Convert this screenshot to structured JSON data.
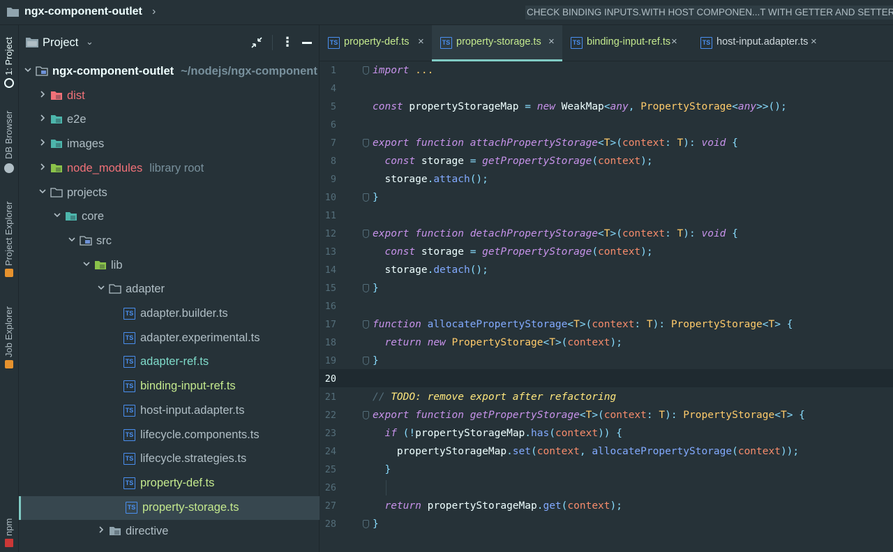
{
  "navbar": {
    "project_name": "ngx-component-outlet",
    "run_config": "CHECK BINDING INPUTS.WITH HOST COMPONEN...T WITH GETTER AND SETTER.A"
  },
  "tool_strip": [
    {
      "label": "1: Project",
      "active": true
    },
    {
      "label": "DB Browser",
      "active": false
    },
    {
      "label": "Project Explorer",
      "active": false
    },
    {
      "label": "Job Explorer",
      "active": false
    },
    {
      "label": "npm",
      "active": false
    }
  ],
  "panel": {
    "title": "Project"
  },
  "tree": [
    {
      "name": "ngx-component-outlet",
      "hint": "~/nodejs/ngx-component",
      "depth": 0,
      "expanded": true,
      "icon": "folder",
      "color": "default",
      "bold": true
    },
    {
      "name": "dist",
      "depth": 1,
      "expanded": false,
      "icon": "folder-red",
      "color": "red"
    },
    {
      "name": "e2e",
      "depth": 1,
      "expanded": false,
      "icon": "folder-teal",
      "color": "default"
    },
    {
      "name": "images",
      "depth": 1,
      "expanded": false,
      "icon": "folder-teal",
      "color": "default"
    },
    {
      "name": "node_modules",
      "hint": "library root",
      "depth": 1,
      "expanded": false,
      "icon": "folder-green",
      "color": "red"
    },
    {
      "name": "projects",
      "depth": 1,
      "expanded": true,
      "icon": "folder-outline",
      "color": "default"
    },
    {
      "name": "core",
      "depth": 2,
      "expanded": true,
      "icon": "folder-teal",
      "color": "default"
    },
    {
      "name": "src",
      "depth": 3,
      "expanded": true,
      "icon": "folder-blue",
      "color": "default"
    },
    {
      "name": "lib",
      "depth": 4,
      "expanded": true,
      "icon": "folder-green",
      "color": "default"
    },
    {
      "name": "adapter",
      "depth": 5,
      "expanded": true,
      "icon": "folder-outline",
      "color": "default"
    },
    {
      "name": "adapter.builder.ts",
      "depth": 6,
      "icon": "ts",
      "color": "normal"
    },
    {
      "name": "adapter.experimental.ts",
      "depth": 6,
      "icon": "ts",
      "color": "normal"
    },
    {
      "name": "adapter-ref.ts",
      "depth": 6,
      "icon": "ts",
      "color": "modified"
    },
    {
      "name": "binding-input-ref.ts",
      "depth": 6,
      "icon": "ts",
      "color": "green"
    },
    {
      "name": "host-input.adapter.ts",
      "depth": 6,
      "icon": "ts",
      "color": "normal"
    },
    {
      "name": "lifecycle.components.ts",
      "depth": 6,
      "icon": "ts",
      "color": "normal"
    },
    {
      "name": "lifecycle.strategies.ts",
      "depth": 6,
      "icon": "ts",
      "color": "normal"
    },
    {
      "name": "property-def.ts",
      "depth": 6,
      "icon": "ts",
      "color": "green"
    },
    {
      "name": "property-storage.ts",
      "depth": 6,
      "icon": "ts",
      "color": "green",
      "selected": true
    },
    {
      "name": "directive",
      "depth": 5,
      "expanded": false,
      "icon": "folder-grey",
      "color": "normal"
    }
  ],
  "tabs": [
    {
      "label": "property-def.ts",
      "color": "green",
      "active": false
    },
    {
      "label": "property-storage.ts",
      "color": "green",
      "active": true
    },
    {
      "label": "binding-input-ref.ts",
      "color": "green",
      "active": false
    },
    {
      "label": "host-input.adapter.ts",
      "color": "normal",
      "active": false
    }
  ],
  "ts_badge": "TS",
  "current_line": 20,
  "code_lines": [
    {
      "n": "1",
      "tokens": [
        [
          "kw",
          "import"
        ],
        [
          "p",
          " "
        ],
        [
          "ty",
          "..."
        ]
      ]
    },
    {
      "n": "4",
      "tokens": []
    },
    {
      "n": "5",
      "tokens": [
        [
          "kw",
          "const"
        ],
        [
          "p",
          " propertyStorageMap "
        ],
        [
          "pu",
          "="
        ],
        [
          "p",
          " "
        ],
        [
          "kw",
          "new"
        ],
        [
          "p",
          " WeakMap"
        ],
        [
          "pu",
          "<"
        ],
        [
          "kw",
          "any"
        ],
        [
          "pu",
          ", "
        ],
        [
          "ty",
          "PropertyStorage"
        ],
        [
          "pu",
          "<"
        ],
        [
          "kw",
          "any"
        ],
        [
          "pu",
          ">>();"
        ]
      ]
    },
    {
      "n": "6",
      "tokens": []
    },
    {
      "n": "7",
      "tokens": [
        [
          "kw",
          "export"
        ],
        [
          "p",
          " "
        ],
        [
          "kw",
          "function"
        ],
        [
          "p",
          " "
        ],
        [
          "fn",
          "attachPropertyStorage"
        ],
        [
          "pu",
          "<"
        ],
        [
          "ty",
          "T"
        ],
        [
          "pu",
          ">("
        ],
        [
          "pm",
          "context"
        ],
        [
          "pu",
          ": "
        ],
        [
          "ty",
          "T"
        ],
        [
          "pu",
          "): "
        ],
        [
          "kw",
          "void"
        ],
        [
          "p",
          " "
        ],
        [
          "pu",
          "{"
        ]
      ]
    },
    {
      "n": "8",
      "tokens": [
        [
          "p",
          "  "
        ],
        [
          "kw",
          "const"
        ],
        [
          "p",
          " storage "
        ],
        [
          "pu",
          "="
        ],
        [
          "p",
          " "
        ],
        [
          "fn",
          "getPropertyStorage"
        ],
        [
          "pu",
          "("
        ],
        [
          "pm",
          "context"
        ],
        [
          "pu",
          ");"
        ]
      ]
    },
    {
      "n": "9",
      "tokens": [
        [
          "p",
          "  storage"
        ],
        [
          "pu",
          "."
        ],
        [
          "fnc",
          "attach"
        ],
        [
          "pu",
          "();"
        ]
      ]
    },
    {
      "n": "10",
      "tokens": [
        [
          "pu",
          "}"
        ]
      ]
    },
    {
      "n": "11",
      "tokens": []
    },
    {
      "n": "12",
      "tokens": [
        [
          "kw",
          "export"
        ],
        [
          "p",
          " "
        ],
        [
          "kw",
          "function"
        ],
        [
          "p",
          " "
        ],
        [
          "fn",
          "detachPropertyStorage"
        ],
        [
          "pu",
          "<"
        ],
        [
          "ty",
          "T"
        ],
        [
          "pu",
          ">("
        ],
        [
          "pm",
          "context"
        ],
        [
          "pu",
          ": "
        ],
        [
          "ty",
          "T"
        ],
        [
          "pu",
          "): "
        ],
        [
          "kw",
          "void"
        ],
        [
          "p",
          " "
        ],
        [
          "pu",
          "{"
        ]
      ]
    },
    {
      "n": "13",
      "tokens": [
        [
          "p",
          "  "
        ],
        [
          "kw",
          "const"
        ],
        [
          "p",
          " storage "
        ],
        [
          "pu",
          "="
        ],
        [
          "p",
          " "
        ],
        [
          "fn",
          "getPropertyStorage"
        ],
        [
          "pu",
          "("
        ],
        [
          "pm",
          "context"
        ],
        [
          "pu",
          ");"
        ]
      ]
    },
    {
      "n": "14",
      "tokens": [
        [
          "p",
          "  storage"
        ],
        [
          "pu",
          "."
        ],
        [
          "fnc",
          "detach"
        ],
        [
          "pu",
          "();"
        ]
      ]
    },
    {
      "n": "15",
      "tokens": [
        [
          "pu",
          "}"
        ]
      ]
    },
    {
      "n": "16",
      "tokens": []
    },
    {
      "n": "17",
      "tokens": [
        [
          "kw",
          "function"
        ],
        [
          "p",
          " "
        ],
        [
          "fnc",
          "allocatePropertyStorage"
        ],
        [
          "pu",
          "<"
        ],
        [
          "ty",
          "T"
        ],
        [
          "pu",
          ">("
        ],
        [
          "pm",
          "context"
        ],
        [
          "pu",
          ": "
        ],
        [
          "ty",
          "T"
        ],
        [
          "pu",
          "): "
        ],
        [
          "ty",
          "PropertyStorage"
        ],
        [
          "pu",
          "<"
        ],
        [
          "ty",
          "T"
        ],
        [
          "pu",
          "> {"
        ]
      ]
    },
    {
      "n": "18",
      "tokens": [
        [
          "p",
          "  "
        ],
        [
          "kw",
          "return"
        ],
        [
          "p",
          " "
        ],
        [
          "kw",
          "new"
        ],
        [
          "p",
          " "
        ],
        [
          "ty",
          "PropertyStorage"
        ],
        [
          "pu",
          "<"
        ],
        [
          "ty",
          "T"
        ],
        [
          "pu",
          ">("
        ],
        [
          "pm",
          "context"
        ],
        [
          "pu",
          ");"
        ]
      ]
    },
    {
      "n": "19",
      "tokens": [
        [
          "pu",
          "}"
        ]
      ]
    },
    {
      "n": "20",
      "tokens": []
    },
    {
      "n": "21",
      "tokens": [
        [
          "cm",
          "// "
        ],
        [
          "td",
          "TODO: remove export after refactoring"
        ]
      ]
    },
    {
      "n": "22",
      "tokens": [
        [
          "kw",
          "export"
        ],
        [
          "p",
          " "
        ],
        [
          "kw",
          "function"
        ],
        [
          "p",
          " "
        ],
        [
          "fn",
          "getPropertyStorage"
        ],
        [
          "pu",
          "<"
        ],
        [
          "ty",
          "T"
        ],
        [
          "pu",
          ">("
        ],
        [
          "pm",
          "context"
        ],
        [
          "pu",
          ": "
        ],
        [
          "ty",
          "T"
        ],
        [
          "pu",
          "): "
        ],
        [
          "ty",
          "PropertyStorage"
        ],
        [
          "pu",
          "<"
        ],
        [
          "ty",
          "T"
        ],
        [
          "pu",
          "> {"
        ]
      ]
    },
    {
      "n": "23",
      "tokens": [
        [
          "p",
          "  "
        ],
        [
          "kw",
          "if"
        ],
        [
          "p",
          " "
        ],
        [
          "pu",
          "(!"
        ],
        [
          "p",
          "propertyStorageMap"
        ],
        [
          "pu",
          "."
        ],
        [
          "fnc",
          "has"
        ],
        [
          "pu",
          "("
        ],
        [
          "pm",
          "context"
        ],
        [
          "pu",
          ")) {"
        ]
      ]
    },
    {
      "n": "24",
      "tokens": [
        [
          "p",
          "    propertyStorageMap"
        ],
        [
          "pu",
          "."
        ],
        [
          "fnc",
          "set"
        ],
        [
          "pu",
          "("
        ],
        [
          "pm",
          "context"
        ],
        [
          "pu",
          ", "
        ],
        [
          "fnc",
          "allocatePropertyStorage"
        ],
        [
          "pu",
          "("
        ],
        [
          "pm",
          "context"
        ],
        [
          "pu",
          "));"
        ]
      ]
    },
    {
      "n": "25",
      "tokens": [
        [
          "p",
          "  "
        ],
        [
          "pu",
          "}"
        ]
      ]
    },
    {
      "n": "26",
      "tokens": []
    },
    {
      "n": "27",
      "tokens": [
        [
          "p",
          "  "
        ],
        [
          "kw",
          "return"
        ],
        [
          "p",
          " propertyStorageMap"
        ],
        [
          "pu",
          "."
        ],
        [
          "fnc",
          "get"
        ],
        [
          "pu",
          "("
        ],
        [
          "pm",
          "context"
        ],
        [
          "pu",
          ");"
        ]
      ]
    },
    {
      "n": "28",
      "tokens": [
        [
          "pu",
          "}"
        ]
      ]
    }
  ]
}
